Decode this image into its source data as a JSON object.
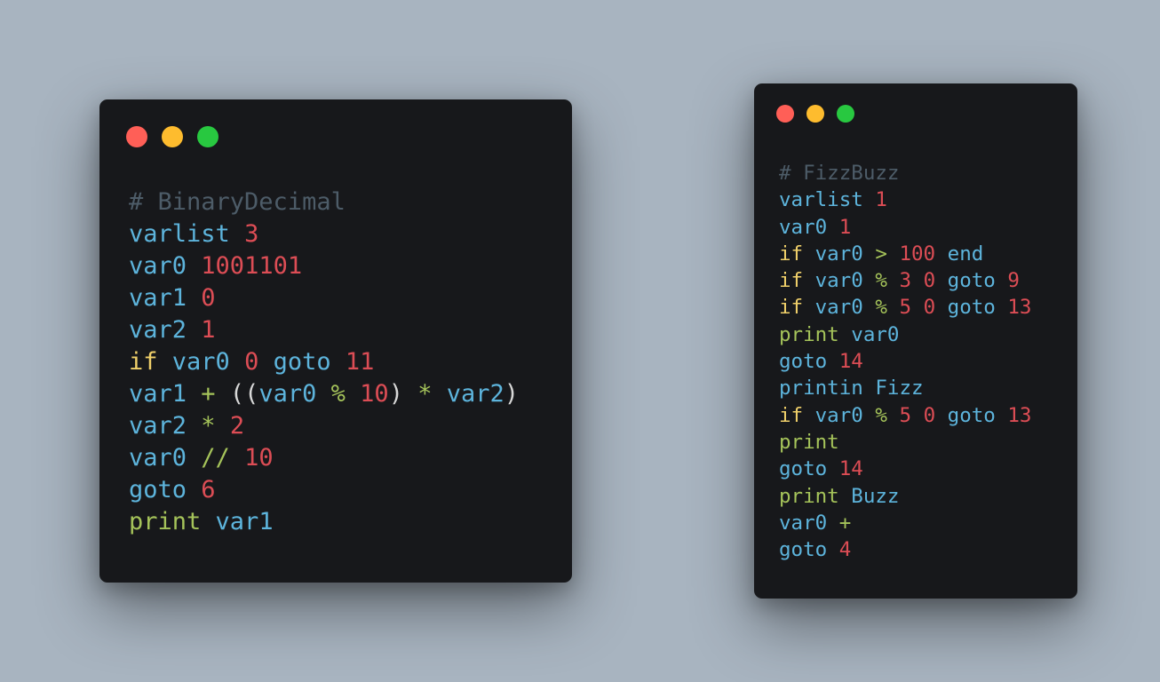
{
  "colors": {
    "background": "#a8b4c0",
    "window_bg": "#17181b",
    "dot_close": "#ff5f57",
    "dot_minimize": "#febc2e",
    "dot_maximize": "#28c840",
    "comment": "#4d5c68",
    "variable": "#5db4dc",
    "number": "#dc4d55",
    "keyword": "#f0d06a",
    "operator": "#a5c35a",
    "paren": "#d8d8d8"
  },
  "windows": [
    {
      "id": "binary-decimal",
      "lines": [
        [
          {
            "t": "# BinaryDecimal",
            "k": "comment"
          }
        ],
        [
          {
            "t": "varlist",
            "k": "var"
          },
          {
            "t": " ",
            "k": "space"
          },
          {
            "t": "3",
            "k": "num"
          }
        ],
        [
          {
            "t": "var0",
            "k": "var"
          },
          {
            "t": " ",
            "k": "space"
          },
          {
            "t": "1001101",
            "k": "num"
          }
        ],
        [
          {
            "t": "var1",
            "k": "var"
          },
          {
            "t": " ",
            "k": "space"
          },
          {
            "t": "0",
            "k": "num"
          }
        ],
        [
          {
            "t": "var2",
            "k": "var"
          },
          {
            "t": " ",
            "k": "space"
          },
          {
            "t": "1",
            "k": "num"
          }
        ],
        [
          {
            "t": "if",
            "k": "kw"
          },
          {
            "t": " ",
            "k": "space"
          },
          {
            "t": "var0",
            "k": "var"
          },
          {
            "t": " ",
            "k": "space"
          },
          {
            "t": "0",
            "k": "num"
          },
          {
            "t": " ",
            "k": "space"
          },
          {
            "t": "goto",
            "k": "var"
          },
          {
            "t": " ",
            "k": "space"
          },
          {
            "t": "11",
            "k": "num"
          }
        ],
        [
          {
            "t": "var1",
            "k": "var"
          },
          {
            "t": " ",
            "k": "space"
          },
          {
            "t": "+",
            "k": "op"
          },
          {
            "t": " ",
            "k": "space"
          },
          {
            "t": "((",
            "k": "paren"
          },
          {
            "t": "var0",
            "k": "var"
          },
          {
            "t": " ",
            "k": "space"
          },
          {
            "t": "%",
            "k": "op"
          },
          {
            "t": " ",
            "k": "space"
          },
          {
            "t": "10",
            "k": "num"
          },
          {
            "t": ")",
            "k": "paren"
          },
          {
            "t": " ",
            "k": "space"
          },
          {
            "t": "*",
            "k": "op"
          },
          {
            "t": " ",
            "k": "space"
          },
          {
            "t": "var2",
            "k": "var"
          },
          {
            "t": ")",
            "k": "paren"
          }
        ],
        [
          {
            "t": "var2",
            "k": "var"
          },
          {
            "t": " ",
            "k": "space"
          },
          {
            "t": "*",
            "k": "op"
          },
          {
            "t": " ",
            "k": "space"
          },
          {
            "t": "2",
            "k": "num"
          }
        ],
        [
          {
            "t": "var0",
            "k": "var"
          },
          {
            "t": " ",
            "k": "space"
          },
          {
            "t": "//",
            "k": "op"
          },
          {
            "t": " ",
            "k": "space"
          },
          {
            "t": "10",
            "k": "num"
          }
        ],
        [
          {
            "t": "goto",
            "k": "var"
          },
          {
            "t": " ",
            "k": "space"
          },
          {
            "t": "6",
            "k": "num"
          }
        ],
        [
          {
            "t": "print",
            "k": "op"
          },
          {
            "t": " ",
            "k": "space"
          },
          {
            "t": "var1",
            "k": "var"
          }
        ]
      ]
    },
    {
      "id": "fizzbuzz",
      "lines": [
        [
          {
            "t": "# FizzBuzz",
            "k": "comment"
          }
        ],
        [
          {
            "t": "varlist",
            "k": "var"
          },
          {
            "t": " ",
            "k": "space"
          },
          {
            "t": "1",
            "k": "num"
          }
        ],
        [
          {
            "t": "var0",
            "k": "var"
          },
          {
            "t": " ",
            "k": "space"
          },
          {
            "t": "1",
            "k": "num"
          }
        ],
        [
          {
            "t": "if",
            "k": "kw"
          },
          {
            "t": " ",
            "k": "space"
          },
          {
            "t": "var0",
            "k": "var"
          },
          {
            "t": " ",
            "k": "space"
          },
          {
            "t": ">",
            "k": "op"
          },
          {
            "t": " ",
            "k": "space"
          },
          {
            "t": "100",
            "k": "num"
          },
          {
            "t": " ",
            "k": "space"
          },
          {
            "t": "end",
            "k": "var"
          }
        ],
        [
          {
            "t": "if",
            "k": "kw"
          },
          {
            "t": " ",
            "k": "space"
          },
          {
            "t": "var0",
            "k": "var"
          },
          {
            "t": " ",
            "k": "space"
          },
          {
            "t": "%",
            "k": "op"
          },
          {
            "t": " ",
            "k": "space"
          },
          {
            "t": "3",
            "k": "num"
          },
          {
            "t": " ",
            "k": "space"
          },
          {
            "t": "0",
            "k": "num"
          },
          {
            "t": " ",
            "k": "space"
          },
          {
            "t": "goto",
            "k": "var"
          },
          {
            "t": " ",
            "k": "space"
          },
          {
            "t": "9",
            "k": "num"
          }
        ],
        [
          {
            "t": "if",
            "k": "kw"
          },
          {
            "t": " ",
            "k": "space"
          },
          {
            "t": "var0",
            "k": "var"
          },
          {
            "t": " ",
            "k": "space"
          },
          {
            "t": "%",
            "k": "op"
          },
          {
            "t": " ",
            "k": "space"
          },
          {
            "t": "5",
            "k": "num"
          },
          {
            "t": " ",
            "k": "space"
          },
          {
            "t": "0",
            "k": "num"
          },
          {
            "t": " ",
            "k": "space"
          },
          {
            "t": "goto",
            "k": "var"
          },
          {
            "t": " ",
            "k": "space"
          },
          {
            "t": "13",
            "k": "num"
          }
        ],
        [
          {
            "t": "print",
            "k": "op"
          },
          {
            "t": " ",
            "k": "space"
          },
          {
            "t": "var0",
            "k": "var"
          }
        ],
        [
          {
            "t": "goto",
            "k": "var"
          },
          {
            "t": " ",
            "k": "space"
          },
          {
            "t": "14",
            "k": "num"
          }
        ],
        [
          {
            "t": "printin",
            "k": "var"
          },
          {
            "t": " ",
            "k": "space"
          },
          {
            "t": "Fizz",
            "k": "var"
          }
        ],
        [
          {
            "t": "if",
            "k": "kw"
          },
          {
            "t": " ",
            "k": "space"
          },
          {
            "t": "var0",
            "k": "var"
          },
          {
            "t": " ",
            "k": "space"
          },
          {
            "t": "%",
            "k": "op"
          },
          {
            "t": " ",
            "k": "space"
          },
          {
            "t": "5",
            "k": "num"
          },
          {
            "t": " ",
            "k": "space"
          },
          {
            "t": "0",
            "k": "num"
          },
          {
            "t": " ",
            "k": "space"
          },
          {
            "t": "goto",
            "k": "var"
          },
          {
            "t": " ",
            "k": "space"
          },
          {
            "t": "13",
            "k": "num"
          }
        ],
        [
          {
            "t": "print",
            "k": "op"
          }
        ],
        [
          {
            "t": "goto",
            "k": "var"
          },
          {
            "t": " ",
            "k": "space"
          },
          {
            "t": "14",
            "k": "num"
          }
        ],
        [
          {
            "t": "print",
            "k": "op"
          },
          {
            "t": " ",
            "k": "space"
          },
          {
            "t": "Buzz",
            "k": "var"
          }
        ],
        [
          {
            "t": "var0",
            "k": "var"
          },
          {
            "t": " ",
            "k": "space"
          },
          {
            "t": "+",
            "k": "op"
          }
        ],
        [
          {
            "t": "goto",
            "k": "var"
          },
          {
            "t": " ",
            "k": "space"
          },
          {
            "t": "4",
            "k": "num"
          }
        ]
      ]
    }
  ]
}
